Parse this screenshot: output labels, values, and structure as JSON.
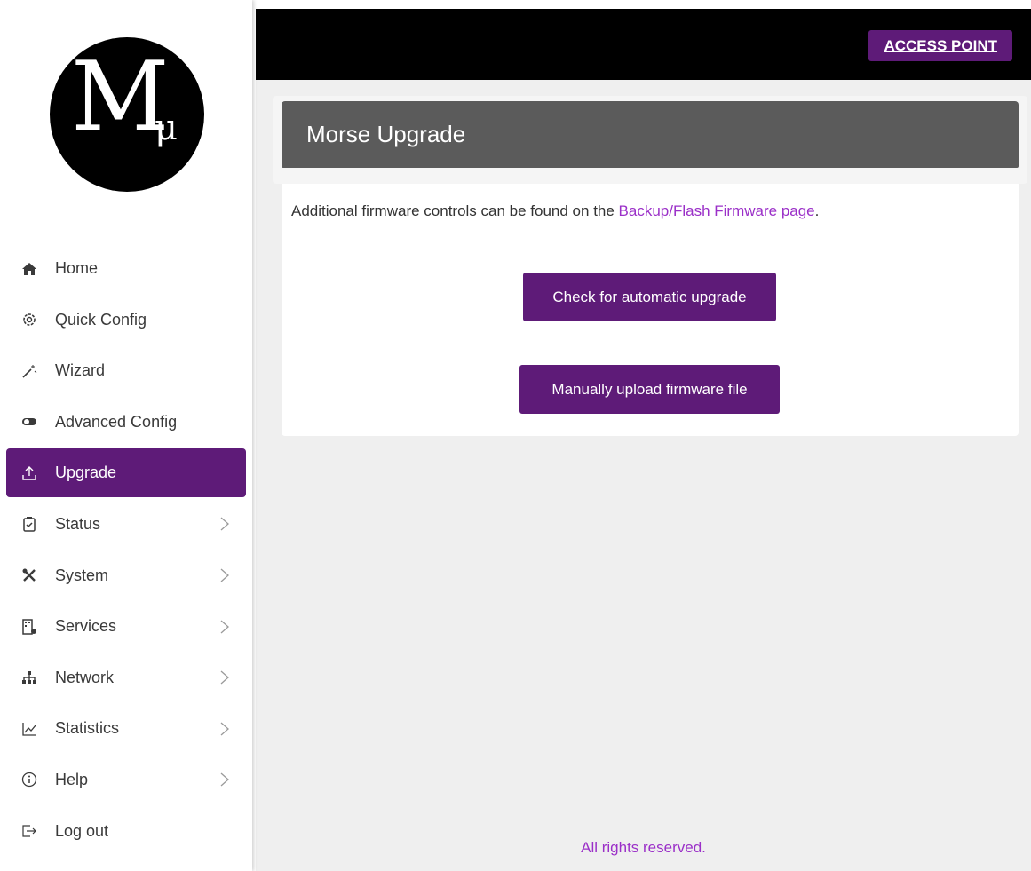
{
  "topbar": {
    "access_point_label": "ACCESS POINT"
  },
  "logo": {
    "letter": "M",
    "sub": "μ"
  },
  "sidebar": {
    "items": [
      {
        "label": "Home",
        "icon": "home-icon"
      },
      {
        "label": "Quick Config",
        "icon": "gear-icon"
      },
      {
        "label": "Wizard",
        "icon": "magic-wand-icon"
      },
      {
        "label": "Advanced Config",
        "icon": "toggle-icon"
      },
      {
        "label": "Upgrade",
        "icon": "upload-icon",
        "active": true
      },
      {
        "label": "Status",
        "icon": "clipboard-check-icon",
        "expandable": true
      },
      {
        "label": "System",
        "icon": "tools-icon",
        "expandable": true
      },
      {
        "label": "Services",
        "icon": "building-gear-icon",
        "expandable": true
      },
      {
        "label": "Network",
        "icon": "network-icon",
        "expandable": true
      },
      {
        "label": "Statistics",
        "icon": "chart-line-icon",
        "expandable": true
      },
      {
        "label": "Help",
        "icon": "info-icon",
        "expandable": true
      },
      {
        "label": "Log out",
        "icon": "logout-icon"
      }
    ]
  },
  "main": {
    "title": "Morse Upgrade",
    "info_prefix": "Additional firmware controls can be found on the ",
    "info_link": "Backup/Flash Firmware page",
    "info_suffix": ".",
    "auto_button": "Check for automatic upgrade",
    "manual_button": "Manually upload firmware file"
  },
  "footer": {
    "text": "All rights reserved."
  },
  "colors": {
    "accent": "#5e1b78",
    "link": "#9b30c8",
    "header_gray": "#5b5b5b"
  }
}
